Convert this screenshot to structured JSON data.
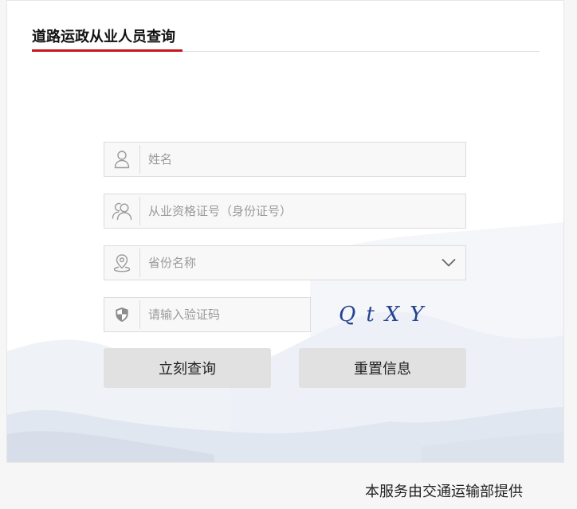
{
  "header": {
    "title": "道路运政从业人员查询"
  },
  "form": {
    "name_field": {
      "placeholder": "姓名",
      "icon": "user-icon"
    },
    "cert_field": {
      "placeholder": "从业资格证号（身份证号）",
      "icon": "users-icon"
    },
    "province_select": {
      "selected": "省份名称",
      "icon": "location-pin-icon",
      "indicator": "chevron-down-icon"
    },
    "captcha_field": {
      "placeholder": "请输入验证码",
      "icon": "shield-icon"
    },
    "captcha_image": {
      "text": "QtXY"
    }
  },
  "buttons": {
    "search_label": "立刻查询",
    "reset_label": "重置信息"
  },
  "footer": {
    "text": "本服务由交通运输部提供"
  },
  "colors": {
    "accent": "#c8161d",
    "button_bg": "#e1e1e1",
    "captcha_text": "#23438f",
    "field_border": "#dcdcdc",
    "page_bg": "#f6f6f6"
  }
}
